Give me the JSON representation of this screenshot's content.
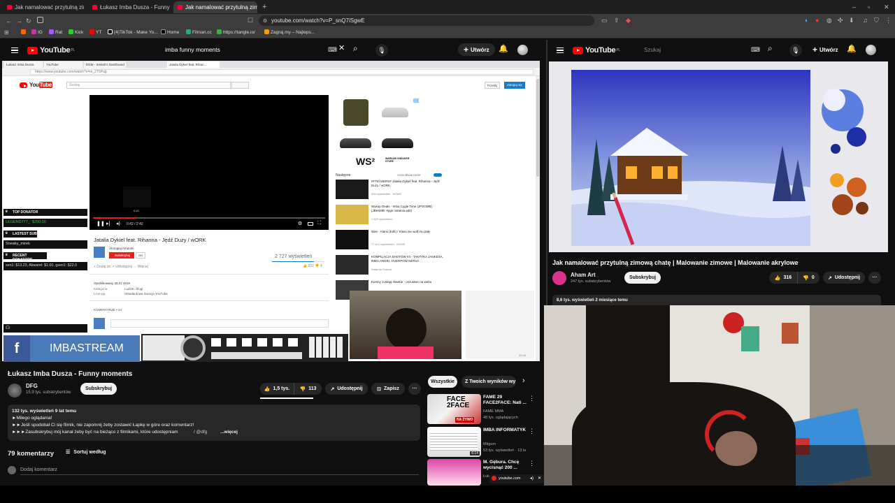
{
  "browser": {
    "tabs": [
      {
        "label": "Jak namalować przytulną zimową cha"
      },
      {
        "label": "Łukasz Imba Dusza - Funny mom"
      },
      {
        "label": "Jak namalować przytulną zimow"
      }
    ],
    "url": "youtube.com/watch?v=P_snQ7iSgwE",
    "bookmarks": [
      "IG",
      "Rat",
      "Kick",
      "YT",
      "(4)TikTok - Make Yo...",
      "Home",
      "Filman.cc",
      "https://tangle.io/",
      "Zagraj.my – Najleps..."
    ]
  },
  "left_yt": {
    "logo": "YouTube",
    "region": "PL",
    "search_value": "imba funny moments",
    "create_label": "Utwórz",
    "video_title": "Łukasz Imba Dusza - Funny moments",
    "channel": "DFG",
    "subs": "15,9 tys. subskrybentów",
    "subscribe": "Subskrybuj",
    "likes": "1,5 tys.",
    "dislikes": "113",
    "share": "Udostępnij",
    "save": "Zapisz",
    "desc_meta": "132 tys. wyświetleń  9 lat temu",
    "desc_lines": [
      "►Miłego oglądania!",
      "►►Jeśli spodobał Ci się filmik, nie zapomnij żeby zostawić Łapkę w góre oraz komentarz!",
      "►►►Zasubskrybuj mój kanał żeby być na bieżąco z filmikami, które udostępniam"
    ],
    "desc_more": "...więcej",
    "desc_handle": "/ @dfg",
    "comments_count": "79 komentarzy",
    "sort_label": "Sortuj według",
    "add_comment": "Dodaj komentarz",
    "chips": [
      "Wszystkie",
      "Z Twoich wyników wy"
    ],
    "suggestions": [
      {
        "title": "FAME 29 FACE2FACE: Nati ...",
        "channel": "FAME MMA",
        "meta": "48 tys. oglądających",
        "thumb_text": "FACE 2FACE",
        "badge": "NA ŻYWO"
      },
      {
        "title": "IMBA INFORMATYK",
        "channel": "Mitgum",
        "meta": "53 tys. wyświetleń · 13 la",
        "duration": "6:14"
      },
      {
        "title": "M. Gębura. Chcę wycisnąć 200 ...",
        "channel": "Łuk",
        "meta": ""
      }
    ]
  },
  "nested": {
    "tabs": [
      "Łukasz Imba Dusza",
      "YouTube",
      "DGM - Smiteb's Dashboard",
      "Jatalia Dykiel feat. Rihan..."
    ],
    "url": "https://www.youtube.com/watch?v=m_2T5Pug",
    "search_placeholder": "Szukaj",
    "upload": "Prześlij",
    "signin": "Zaloguj się",
    "video_time": "0:42 / 2:42",
    "tooltip_time": "0:42",
    "title": "Jatalia Dykiel feat. Rihanna - Jędź Duży / wORK",
    "uploader": "Aforogiaj Arnonim",
    "sub_btn": "Subskrybuj",
    "sub_count": "389",
    "views": "2 727 wyświetleń",
    "published": "Opublikowany 29.07.2016",
    "category_label": "Kategoria",
    "category": "Ludzie i blogi",
    "license_label": "Licencja",
    "license": "Standardowa licencja YouTube",
    "comments": "KOMENTARZE • 44",
    "ad_brand": "WS²",
    "ad_sub": "WARSAW SNEAKER STORE",
    "next_label": "Następne",
    "autoplay": "Autoodtwarzanie",
    "side": [
      {
        "title": "#FTEASERS# Jatalia Dykiel feat. Rihanna - Jędź Duży / wORK",
        "meta": "306 wyświetleń · NOWE"
      },
      {
        "title": "Wykop Deals - Imba Cygle Time (JPSGMB) (JBeSMB +łyge ostatnia edit)",
        "meta": "1 829 wyświetleń"
      },
      {
        "title": "Was - Alans (Edit) / Klass nie wolf mu pały",
        "meta": "77 612 wyświetleń · NOWE"
      },
      {
        "title": "KOMPILACJA SHOTÓW #4 - TAKTYKA JANKESA, IMBA ANGRI, OVERPOW NERVA",
        "meta": "Katarnia Dziwna"
      },
      {
        "title": "Koniny zostają słowkie - oszustwo na webu",
        "meta": ""
      }
    ]
  },
  "stream_overlay": {
    "top_donator_label": "TOP DONATOR",
    "top_donator": "LEGEND777_: $200.00",
    "latest_sub_label": "LASTEST SUB",
    "latest_sub": "Sneaky_mirek",
    "recent_label": "RECENT DONATORS",
    "recent": "sen1: $13.23, Akwarel: $1.00, gsen1: $22.0",
    "banner": "IMBASTREAM",
    "fb": "f",
    "overlay_time": "25:18"
  },
  "right_yt": {
    "logo": "YouTube",
    "region": "PL",
    "search_placeholder": "Szukaj",
    "create_label": "Utwórz",
    "video_title": "Jak namalować przytulną zimową chatę | Malowanie zimowe | Malowanie akrylowe",
    "channel": "Aham Art",
    "subs": "247 tys. subskrybentów",
    "subscribe": "Subskrybuj",
    "likes": "316",
    "dislikes": "0",
    "share": "Udostępnij",
    "desc_meta": "8,6 tys. wyświetleń  2 miesiące temu"
  },
  "mini": {
    "label": "youtube.com"
  },
  "colors": {
    "yt_red": "#ff0000",
    "bg": "#0f0f0f",
    "pill": "#272727"
  }
}
